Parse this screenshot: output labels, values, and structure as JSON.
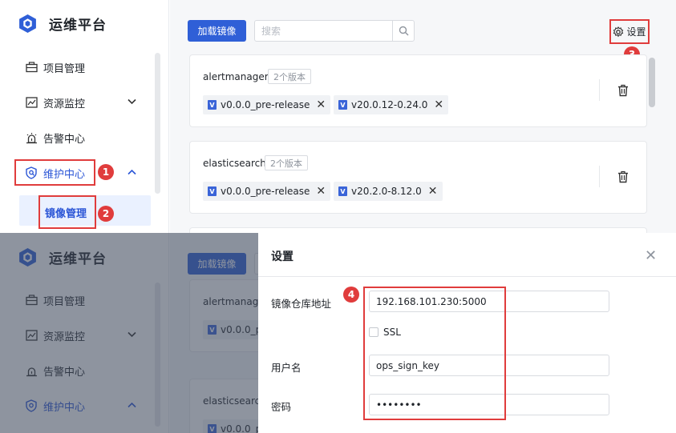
{
  "brand": {
    "title": "运维平台"
  },
  "sidebar": {
    "items": [
      {
        "label": "项目管理"
      },
      {
        "label": "资源监控"
      },
      {
        "label": "告警中心"
      },
      {
        "label": "维护中心"
      }
    ],
    "sub_item": "镜像管理"
  },
  "toolbar": {
    "load_label": "加载镜像",
    "search_placeholder": "搜索",
    "settings_label": "设置"
  },
  "images": [
    {
      "name": "alertmanager",
      "versions_label": "2个版本",
      "versions": [
        "v0.0.0_pre-release",
        "v20.0.12-0.24.0"
      ]
    },
    {
      "name": "elasticsearch",
      "versions_label": "2个版本",
      "versions": [
        "v0.0.0_pre-release",
        "v20.2.0-8.12.0"
      ]
    }
  ],
  "dialog": {
    "title": "设置",
    "registry_label": "镜像仓库地址",
    "registry_value": "192.168.101.230:5000",
    "ssl_label": "SSL",
    "ssl_checked": false,
    "username_label": "用户名",
    "username_value": "ops_sign_key",
    "password_label": "密码",
    "password_value": "••••••••"
  },
  "annotations": [
    "1",
    "2",
    "3",
    "4"
  ],
  "colors": {
    "primary": "#2f5fd7",
    "annotation": "#e03c3c",
    "active_bg": "#eaf1ff"
  }
}
